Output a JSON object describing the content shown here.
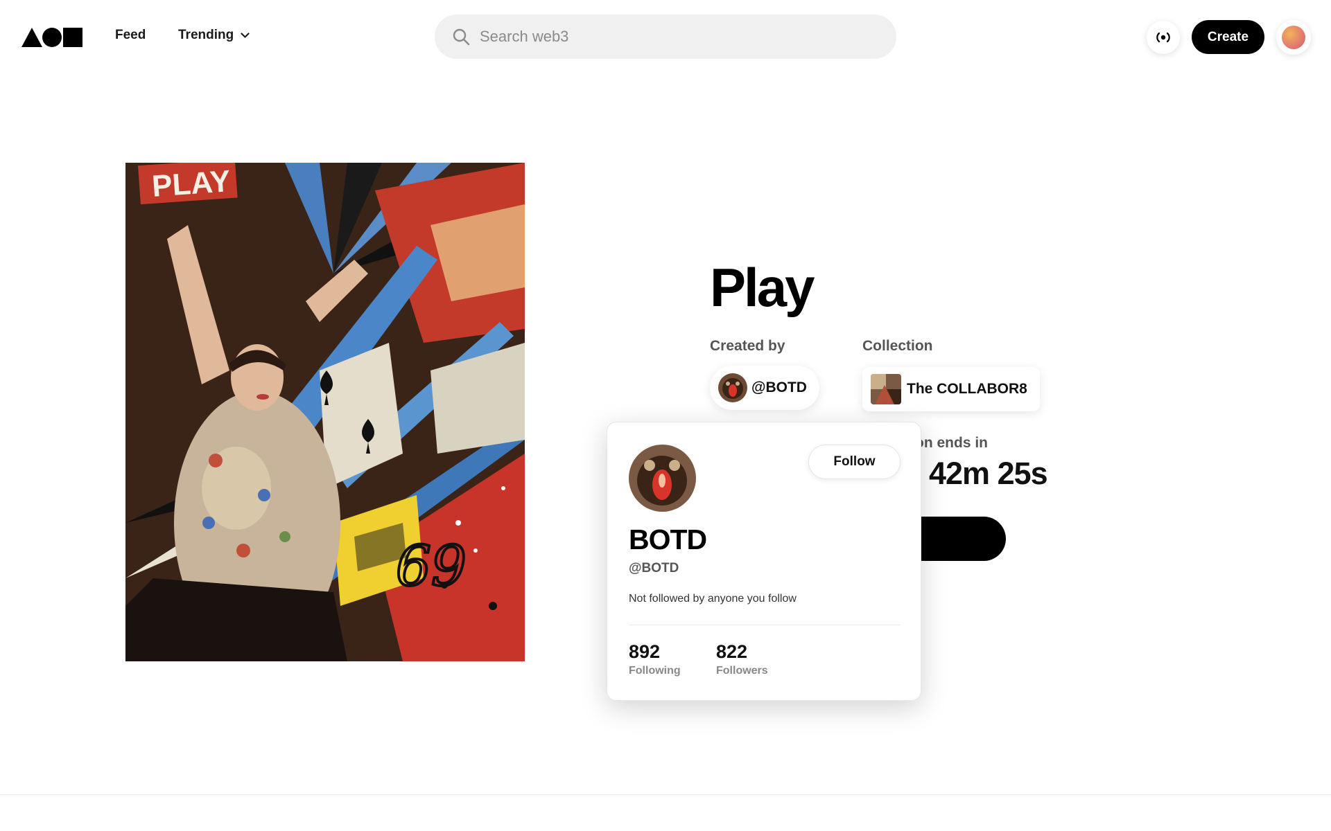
{
  "header": {
    "nav": {
      "feed": "Feed",
      "trending": "Trending"
    },
    "search": {
      "placeholder": "Search web3"
    },
    "create_label": "Create"
  },
  "artwork": {
    "overlay_text": "PLAY"
  },
  "details": {
    "title": "Play",
    "created_by_label": "Created by",
    "creator_handle": "@BOTD",
    "collection_label": "Collection",
    "collection_name": "The COLLABOR8",
    "auction_label": "on ends in",
    "countdown": "42m 25s"
  },
  "hover_card": {
    "follow_label": "Follow",
    "name": "BOTD",
    "handle": "@BOTD",
    "mutual_text": "Not followed by anyone you follow",
    "stats": {
      "following_count": "892",
      "following_label": "Following",
      "followers_count": "822",
      "followers_label": "Followers"
    }
  },
  "icons": {
    "logo": "triangle-circle-square-logo",
    "search": "search-icon",
    "trending_caret": "chevron-down-icon",
    "live": "broadcast-icon"
  },
  "colors": {
    "background": "#ffffff",
    "primary": "#000000",
    "search_bg": "#f0f0f0",
    "muted_text": "#555555"
  }
}
